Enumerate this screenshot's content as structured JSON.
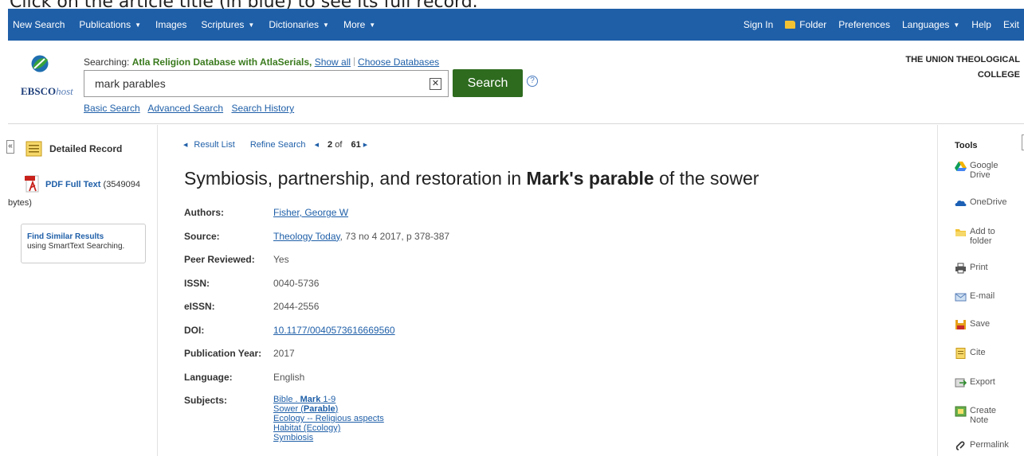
{
  "instruction": "Click on the article title (in blue) to see its full record.",
  "topnav": {
    "left": [
      {
        "label": "New Search",
        "dropdown": false
      },
      {
        "label": "Publications",
        "dropdown": true
      },
      {
        "label": "Images",
        "dropdown": false
      },
      {
        "label": "Scriptures",
        "dropdown": true
      },
      {
        "label": "Dictionaries",
        "dropdown": true
      },
      {
        "label": "More",
        "dropdown": true
      }
    ],
    "sign_in": "Sign In",
    "folder": "Folder",
    "preferences": "Preferences",
    "languages": "Languages",
    "help": "Help",
    "exit": "Exit",
    "bar_color": "#1f5fa8"
  },
  "header": {
    "logo_text": "EBSCO",
    "logo_suffix": "host",
    "searching_prefix": "Searching:",
    "database": "Atla Religion Database with AtlaSerials,",
    "show_all": "Show all",
    "choose_databases": "Choose Databases",
    "search_value": "mark parables",
    "clear_icon": "✕",
    "search_button": "Search",
    "help_glyph": "?",
    "links": [
      "Basic Search",
      "Advanced Search",
      "Search History"
    ],
    "org_line1": "THE UNION THEOLOGICAL",
    "org_line2": "COLLEGE"
  },
  "left_rail": {
    "collapse_glyph": "«",
    "detailed_record": "Detailed Record",
    "pdf_label": "PDF Full Text",
    "pdf_size_a": "(3549094",
    "pdf_size_b": "bytes)",
    "find_similar_title": "Find Similar Results",
    "find_similar_sub": "using SmartText Searching."
  },
  "result_nav": {
    "result_list": "Result List",
    "refine_search": "Refine Search",
    "current": "2",
    "of": "of",
    "total": "61"
  },
  "record": {
    "title_pre": "Symbiosis, partnership, and restoration in ",
    "title_bold": "Mark's parable",
    "title_post": " of the sower",
    "authors_label": "Authors:",
    "authors": "Fisher, George W",
    "source_label": "Source:",
    "source_journal": "Theology Today",
    "source_rest": ", 73 no 4 2017, p 378-387",
    "peer_label": "Peer Reviewed:",
    "peer": "Yes",
    "issn_label": "ISSN:",
    "issn": "0040-5736",
    "eissn_label": "eISSN:",
    "eissn": "2044-2556",
    "doi_label": "DOI:",
    "doi": "10.1177/0040573616669560",
    "year_label": "Publication Year:",
    "year": "2017",
    "language_label": "Language:",
    "language": "English",
    "subjects_label": "Subjects:",
    "subj1_pre": "Bible . ",
    "subj1_bold": "Mark",
    "subj1_post": " 1-9",
    "subj2_pre": "Sower (",
    "subj2_bold": "Parable",
    "subj2_post": ")",
    "subj3": "Ecology -- Religious aspects",
    "subj4": "Habitat (Ecology)",
    "subj5": "Symbiosis"
  },
  "tools": {
    "title": "Tools",
    "google_1": "Google",
    "google_2": "Drive",
    "onedrive": "OneDrive",
    "add_1": "Add to",
    "add_2": "folder",
    "print": "Print",
    "email": "E-mail",
    "save": "Save",
    "cite": "Cite",
    "export": "Export",
    "note_1": "Create",
    "note_2": "Note",
    "permalink": "Permalink"
  }
}
